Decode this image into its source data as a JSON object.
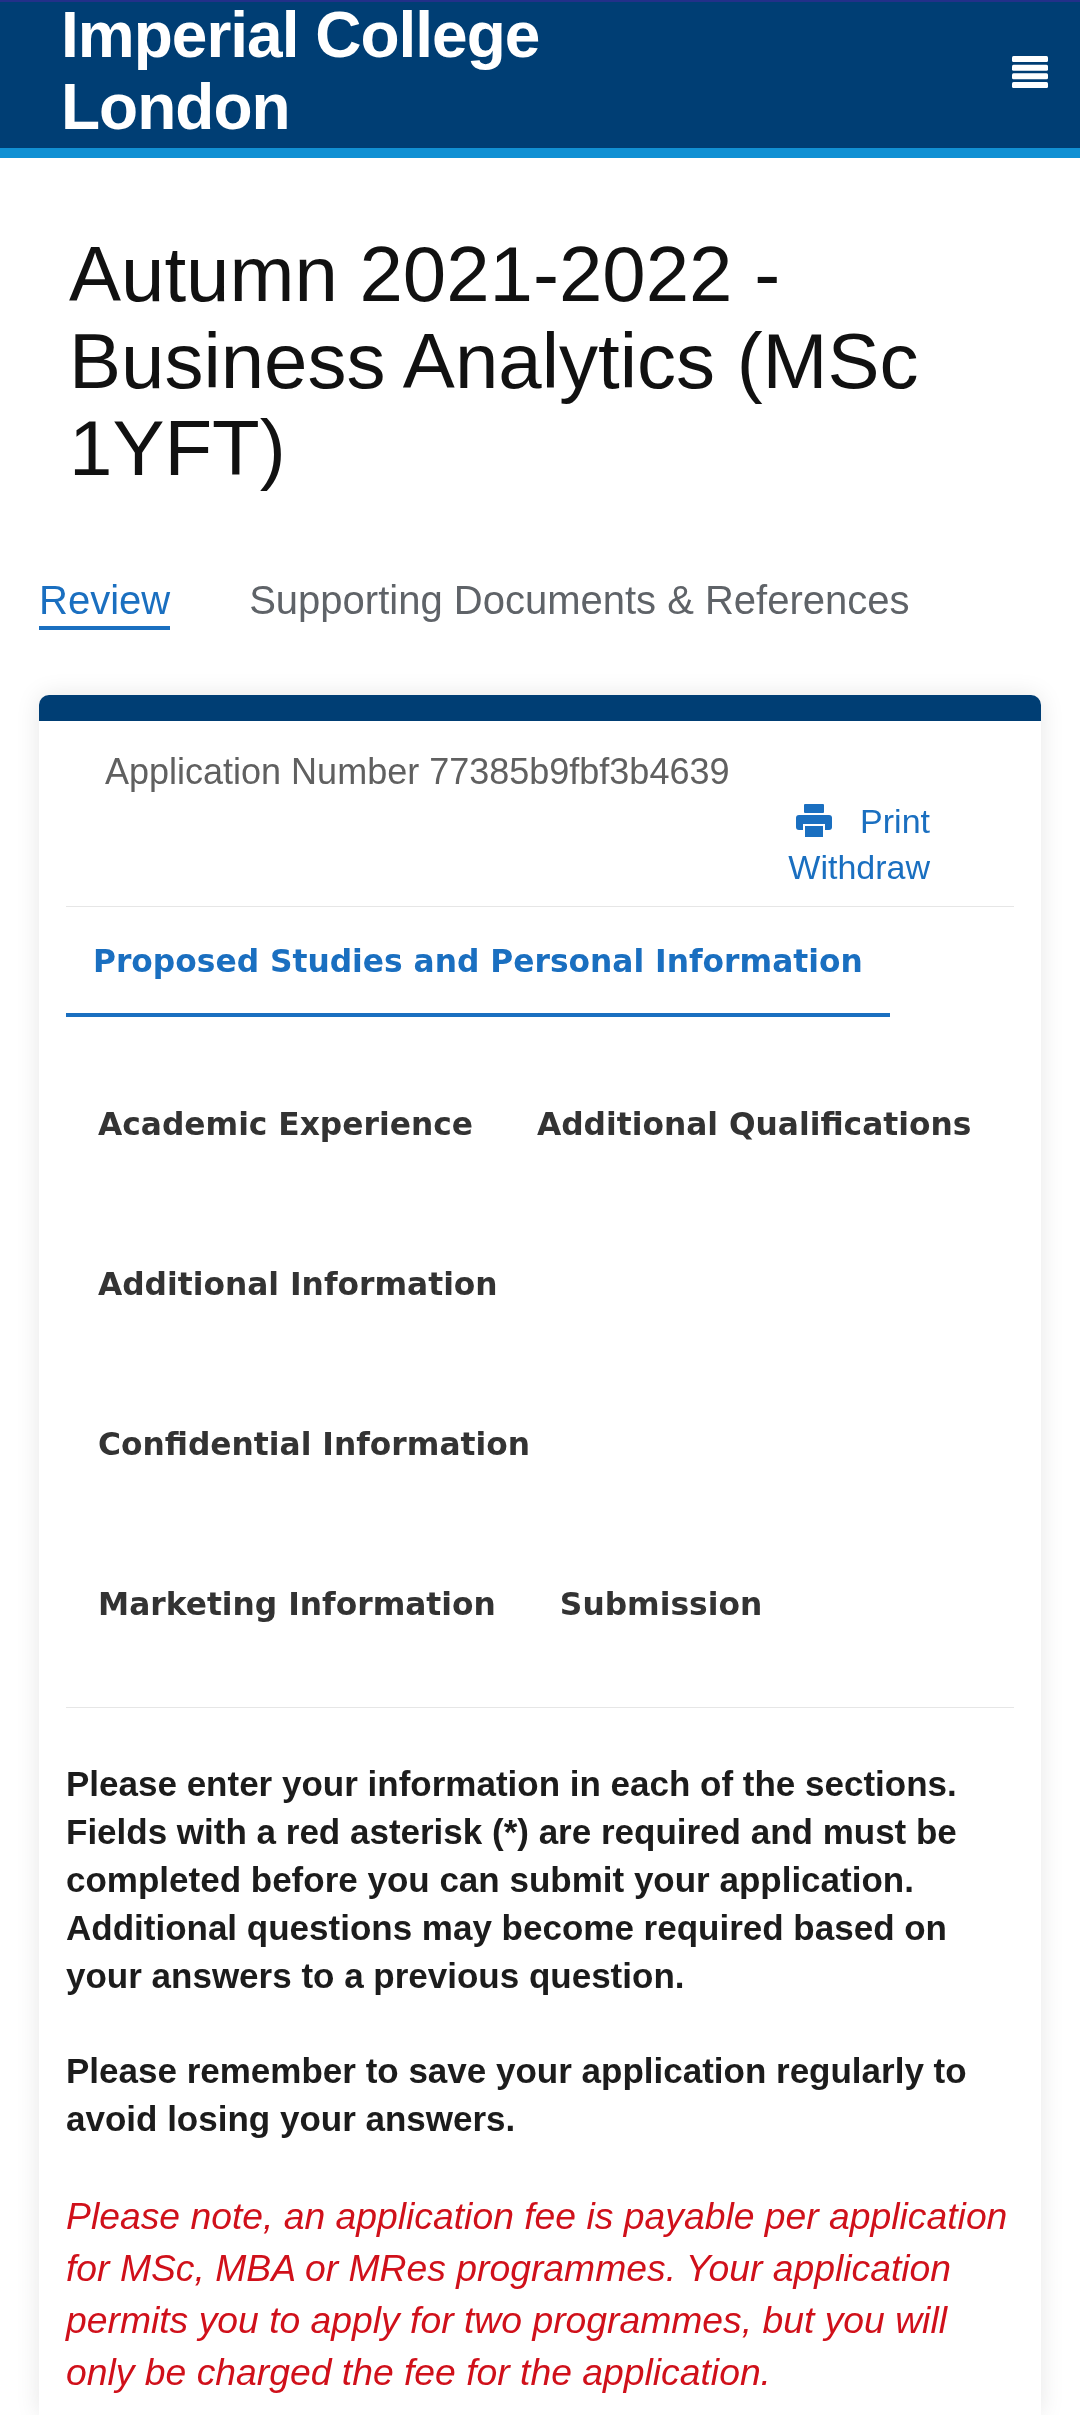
{
  "header": {
    "logo_text": "Imperial College London"
  },
  "page_title": "Autumn 2021-2022 - Business Analytics (MSc 1YFT)",
  "tabs": [
    {
      "label": "Review",
      "selected": true
    },
    {
      "label": "Supporting Documents & References",
      "selected": false
    }
  ],
  "application": {
    "number": "Application Number 77385b9fbf3b4639",
    "actions": [
      {
        "kind": "print",
        "label": "Print"
      },
      {
        "kind": "withdraw",
        "label": "Withdraw"
      }
    ]
  },
  "sections": [
    {
      "label": "Proposed Studies and Personal Information",
      "selected": true
    },
    {
      "label": "Academic Experience",
      "selected": false
    },
    {
      "label": "Additional Qualifications",
      "selected": false
    },
    {
      "label": "Additional Information",
      "selected": false
    },
    {
      "label": "Confidential Information",
      "selected": false
    },
    {
      "label": "Marketing Information",
      "selected": false
    },
    {
      "label": "Submission",
      "selected": false
    }
  ],
  "instructions": [
    {
      "kind": "note",
      "text": "Please enter your information in each of the sections. Fields with a red asterisk (*) are required and must be completed before you can submit your application. Additional questions may become required based on your answers to a previous question."
    },
    {
      "kind": "note",
      "text": "Please remember to save your application regularly to avoid losing your answers."
    },
    {
      "kind": "warning",
      "text": "Please note, an application fee is payable per application for MSc, MBA or MRes programmes. Your application permits you to apply for two programmes, but you will only be charged the fee for the application."
    }
  ]
}
